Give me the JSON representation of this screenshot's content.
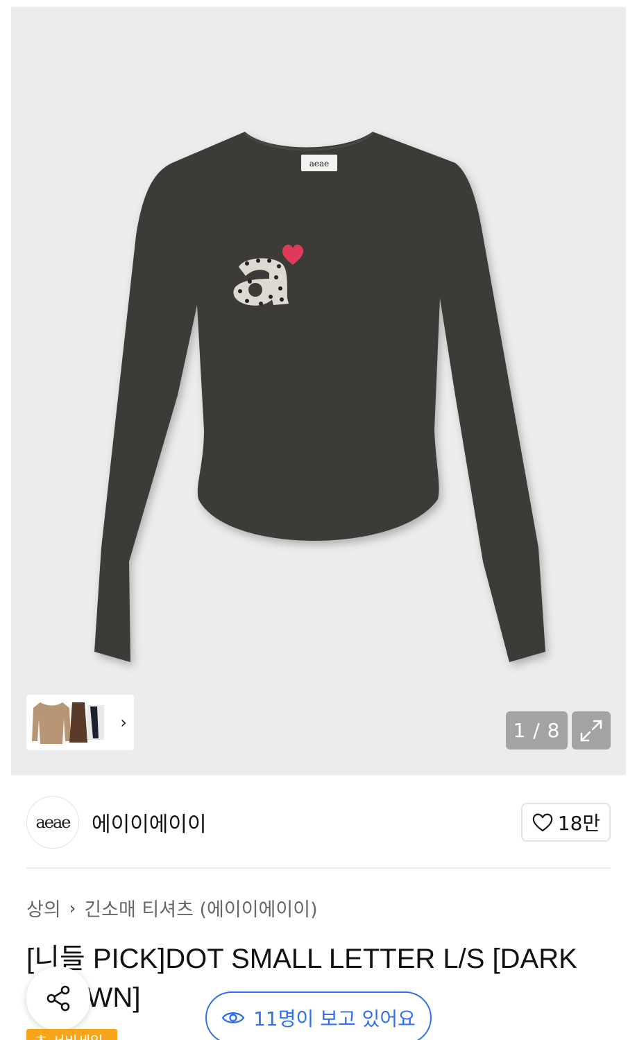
{
  "gallery": {
    "counter": "1 / 8",
    "colors": {
      "background": "#ececec",
      "shirt": "#3d3b38",
      "letter": "#dcdad0",
      "heart": "#e03a5a"
    }
  },
  "brand": {
    "logo_text": "aeae",
    "name": "에이이에이이",
    "likes": "18만"
  },
  "breadcrumb": {
    "category": "상의",
    "subcategory": "긴소매 티셔츠 (에이이에이이)"
  },
  "product": {
    "title": "[니들 PICK]DOT SMALL LETTER L/S [DARK BROWN]"
  },
  "viewers": {
    "text": "11명이 보고 있어요"
  },
  "promo": {
    "badge": "초 서비세일"
  },
  "icons": [
    "heart-icon",
    "share-icon",
    "eye-icon",
    "expand-icon",
    "chevron-right-icon"
  ],
  "accent_color": "#2f6ff0"
}
